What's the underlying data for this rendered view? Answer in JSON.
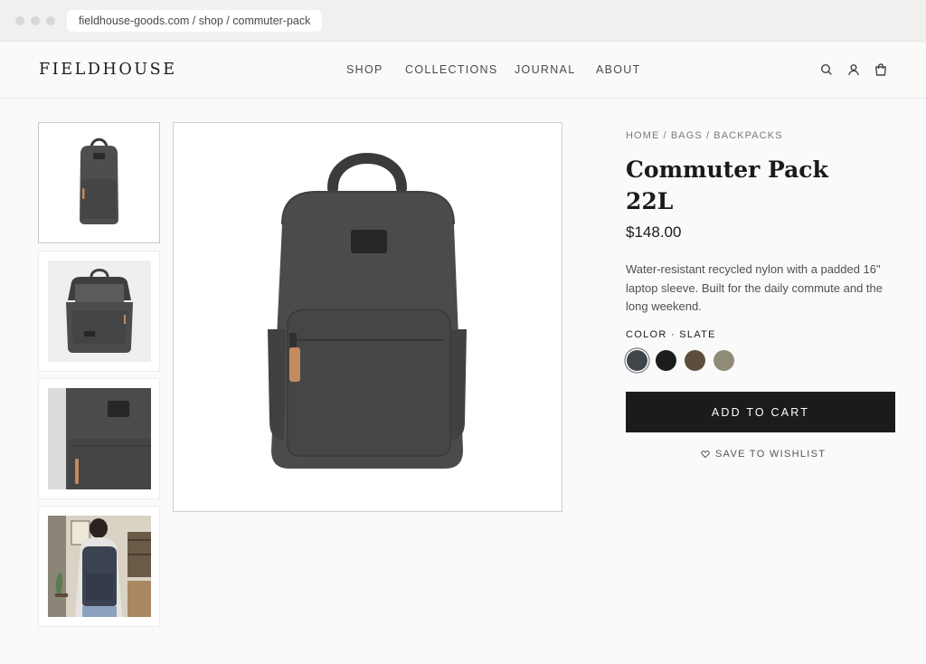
{
  "browser": {
    "url": "fieldhouse-goods.com / shop / commuter-pack"
  },
  "header": {
    "logo": "FIELDHOUSE",
    "nav": [
      "SHOP",
      "COLLECTIONS",
      "JOURNAL",
      "ABOUT"
    ],
    "icons": [
      "search-icon",
      "account-icon",
      "cart-icon"
    ]
  },
  "gallery": {
    "thumbnails": [
      {
        "name": "thumb-front",
        "active": true
      },
      {
        "name": "thumb-open",
        "active": false
      },
      {
        "name": "thumb-detail",
        "active": false
      },
      {
        "name": "thumb-lifestyle",
        "active": false
      }
    ]
  },
  "product": {
    "breadcrumb": "HOME / BAGS / BACKPACKS",
    "title_line1": "Commuter Pack",
    "title_line2": "22L",
    "price": "$148.00",
    "description": "Water-resistant recycled nylon with a padded 16\" laptop sleeve. Built for the daily commute and the long weekend.",
    "color_label": "COLOR · SLATE",
    "swatches": [
      {
        "name": "slate",
        "color": "#3f454b",
        "selected": true
      },
      {
        "name": "black",
        "color": "#1c1c1c",
        "selected": false
      },
      {
        "name": "brown",
        "color": "#5c4d3c",
        "selected": false
      },
      {
        "name": "taupe",
        "color": "#908a78",
        "selected": false
      }
    ],
    "add_to_cart": "ADD TO CART",
    "wishlist": "SAVE TO WISHLIST"
  },
  "colors": {
    "button_bg": "#1b1b1b",
    "pack_body": "#4a4b4d",
    "leather_tab": "#c58a5e"
  }
}
